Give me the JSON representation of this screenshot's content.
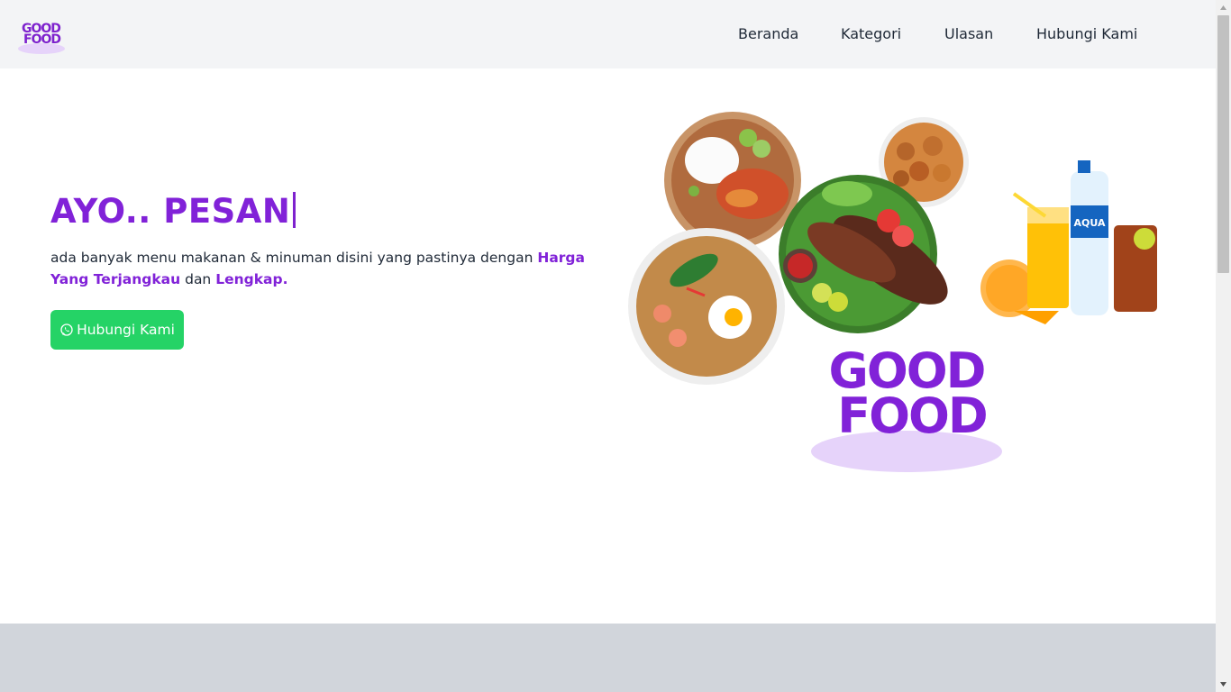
{
  "brand": {
    "logo_line1": "GOOD",
    "logo_line2": "FOOD"
  },
  "nav": {
    "items": [
      {
        "label": "Beranda"
      },
      {
        "label": "Kategori"
      },
      {
        "label": "Ulasan"
      },
      {
        "label": "Hubungi Kami"
      }
    ]
  },
  "hero": {
    "title": "AYO.. PESAN",
    "desc_part1": "ada banyak menu makanan & minuman disini yang pastinya dengan ",
    "desc_highlight1": "Harga Yang Terjangkau",
    "desc_part2": " dan ",
    "desc_highlight2": "Lengkap.",
    "cta_label": "Hubungi Kami",
    "illustration_logo_line1": "GOOD",
    "illustration_logo_line2": "FOOD",
    "bottle_label": "AQUA"
  },
  "colors": {
    "accent": "#8122d8",
    "cta": "#25d366",
    "navbar_bg": "#f3f4f6",
    "bottom_band": "#d1d5db"
  },
  "icons": {
    "cta_icon": "whatsapp-icon"
  }
}
